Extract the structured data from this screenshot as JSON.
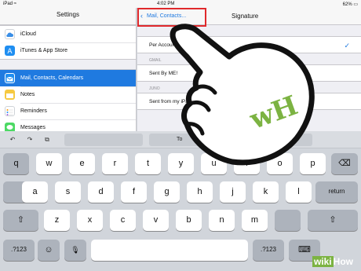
{
  "status_bar": {
    "left": "iPad ≈",
    "center": "4:02 PM",
    "right": "62% ▭"
  },
  "sidebar": {
    "title": "Settings",
    "items": [
      {
        "label": "iCloud",
        "icon": "cloud-icon",
        "color": "#ffffff"
      },
      {
        "label": "iTunes & App Store",
        "icon": "app-store-icon",
        "color": "#1f8ef1"
      },
      {
        "label": "Mail, Contacts, Calendars",
        "icon": "mail-icon",
        "color": "#1f8ef1",
        "selected": true
      },
      {
        "label": "Notes",
        "icon": "notes-icon",
        "color": "#f6c940"
      },
      {
        "label": "Reminders",
        "icon": "reminders-icon",
        "color": "#ffffff"
      },
      {
        "label": "Messages",
        "icon": "messages-icon",
        "color": "#4cd964"
      }
    ]
  },
  "detail": {
    "back_label": "Mail, Contacts...",
    "title": "Signature",
    "rows": [
      {
        "section": "",
        "text": "Per Account",
        "checked": true
      },
      {
        "section": "GMAIL",
        "text": "Sent By ME!"
      },
      {
        "section": "JUNO",
        "text": "Sent from my iPad"
      }
    ]
  },
  "keyboard": {
    "toolbar": {
      "undo": "↶",
      "redo": "↷",
      "paste": "⧉",
      "suggestion": "To"
    },
    "row1": [
      "q",
      "w",
      "e",
      "r",
      "t",
      "y",
      "u",
      "i",
      "o",
      "p"
    ],
    "row2": [
      "a",
      "s",
      "d",
      "f",
      "g",
      "h",
      "j",
      "k",
      "l"
    ],
    "row3": [
      "z",
      "x",
      "c",
      "v",
      "b",
      "n",
      "m"
    ],
    "return_label": "return",
    "numbers_label": ".?123",
    "emoji": "☺",
    "mic": "🎙",
    "backspace": "⌫",
    "shift": "⇧",
    "keyboard_hide": "⌨"
  },
  "overlay": {
    "logo": "wH",
    "watermark_left": "wiki",
    "watermark_right": "How"
  },
  "colors": {
    "accent": "#1f7ae0",
    "highlight": "#e0292c",
    "brand_green": "#7cb342"
  }
}
